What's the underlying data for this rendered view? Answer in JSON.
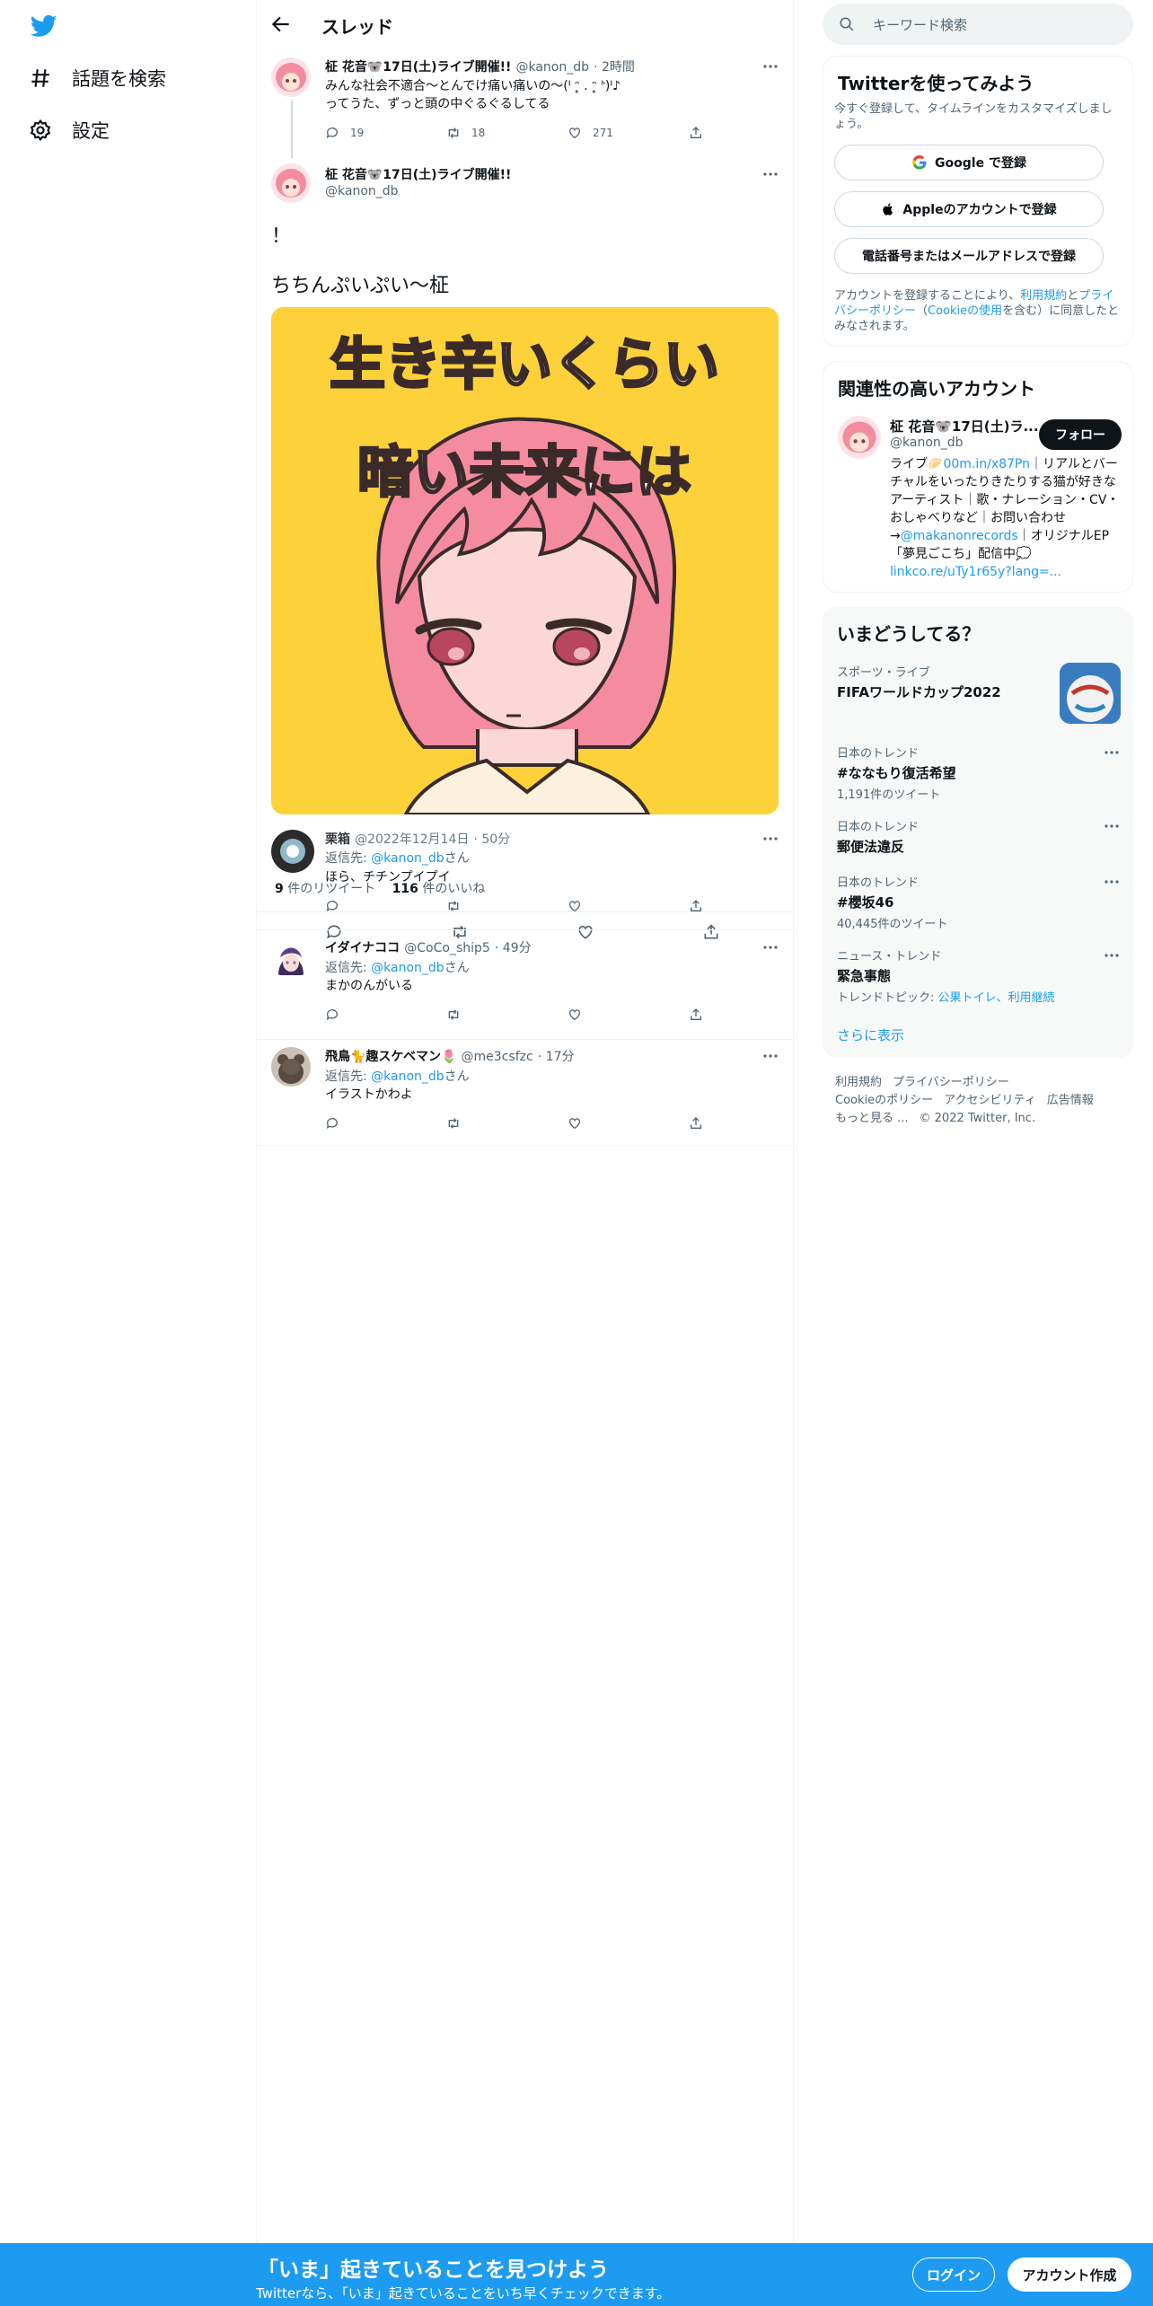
{
  "nav": {
    "explore_label": "話題を検索",
    "settings_label": "設定"
  },
  "header": {
    "title": "スレッド"
  },
  "thread": {
    "parent": {
      "name": "柾 花音🐨17日(土)ライブ開催!!",
      "handle": "@kanon_db",
      "time": "· 2時間",
      "text_line1": "みんな社会不適合〜とんでけ痛い痛いの〜(ᑊ ᵔ̥ . ᵔ̥ ᑋ)ᑊ♪",
      "text_line2": "ってうた、ずっと頭の中ぐるぐるしてる",
      "replies": "19",
      "retweets": "18",
      "likes": "271"
    },
    "main": {
      "name": "柾 花音🐨17日(土)ライブ開催!!",
      "handle": "@kanon_db",
      "text_excl": "！",
      "text_caption": "ちちんぷいぷい〜柾",
      "image_line1": "生き辛いくらい",
      "image_line2": "暗い未来には",
      "overlap_name": "栗箱",
      "overlap_handle": "@2022年12月14日",
      "overlap_time": "· 50分",
      "overlap_text": "ほら、チチンプイプイ",
      "replyto_label": "返信先:",
      "replyto_handle": "@kanon_db",
      "replyto_suffix": "さん",
      "retweet_count": "9",
      "retweet_label": "件のリツイート",
      "like_count": "116",
      "like_label": "件のいいね"
    },
    "replies": [
      {
        "name": "イダイナココ",
        "handle": "@CoCo_ship5",
        "time": "· 49分",
        "replyto_label": "返信先:",
        "replyto_handle": "@kanon_db",
        "replyto_suffix": "さん",
        "text": "まかのんがいる"
      },
      {
        "name": "飛鳥🐈趣スケベマン🌷",
        "handle": "@me3csfzc",
        "time": "· 17分",
        "replyto_label": "返信先:",
        "replyto_handle": "@kanon_db",
        "replyto_suffix": "さん",
        "text": "イラストかわよ"
      }
    ]
  },
  "sidebar": {
    "search_placeholder": "キーワード検索",
    "signup": {
      "title": "Twitterを使ってみよう",
      "subtitle": "今すぐ登録して、タイムラインをカスタマイズしましょう。",
      "google_label": "Google で登録",
      "apple_label": "Appleのアカウントで登録",
      "phone_label": "電話番号またはメールアドレスで登録",
      "terms_prefix": "アカウントを登録することにより、",
      "terms_link": "利用規約",
      "terms_and": "と",
      "privacy_link": "プライバシーポリシー",
      "cookie_open": "（",
      "cookie_link": "Cookieの使用",
      "terms_suffix": "を含む）に同意したとみなされます。"
    },
    "related": {
      "title": "関連性の高いアカウント",
      "name": "柾 花音🐨17日(土)ラ...",
      "handle": "@kanon_db",
      "follow_label": "フォロー",
      "bio_1": "ライブ",
      "bio_link1": "00m.in/x87Pn",
      "bio_2": "｜リアルとバーチャルをいったりきたりする猫が好きなアーティスト｜歌・ナレーション・CV・おしゃべりなど｜お問い合わせ→",
      "bio_link2": "@makanonrecords",
      "bio_3": "｜オリジナルEP「夢見ごこち」配信中",
      "bio_link3": "linkco.re/uTy1r65y?lang=..."
    },
    "trends": {
      "title": "いまどうしてる？",
      "items": [
        {
          "category": "スポーツ・ライブ",
          "title": "FIFAワールドカップ2022",
          "count": ""
        },
        {
          "category": "日本のトレンド",
          "title": "#ななもり復活希望",
          "count": "1,191件のツイート"
        },
        {
          "category": "日本のトレンド",
          "title": "郵便法違反",
          "count": ""
        },
        {
          "category": "日本のトレンド",
          "title": "#櫻坂46",
          "count": "40,445件のツイート"
        },
        {
          "category": "ニュース・トレンド",
          "title": "緊急事態",
          "count": ""
        }
      ],
      "topic_prefix": "トレンドトピック:",
      "topic_links": "公果トイレ、利用継続",
      "show_more": "さらに表示"
    },
    "footer": {
      "terms": "利用規約",
      "privacy": "プライバシーポリシー",
      "cookie": "Cookieのポリシー",
      "accessibility": "アクセシビリティ",
      "ads": "広告情報",
      "more": "もっと見る ...",
      "copyright": "© 2022 Twitter, Inc."
    }
  },
  "bottombar": {
    "title": "「いま」起きていることを見つけよう",
    "subtitle": "Twitterなら、「いま」起きていることをいち早くチェックできます。",
    "login_label": "ログイン",
    "signup_label": "アカウント作成"
  },
  "colors": {
    "accent": "#1d9bf0",
    "image_bg": "#fdd13a",
    "hair": "#f48b9e"
  }
}
